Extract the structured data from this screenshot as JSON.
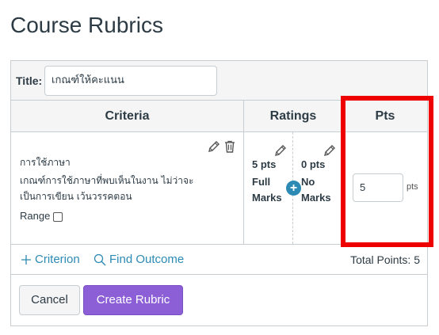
{
  "page": {
    "title": "Course Rubrics"
  },
  "rubric": {
    "title_label": "Title:",
    "title_value": "เกณฑ์ให้คะแนน",
    "headers": {
      "criteria": "Criteria",
      "ratings": "Ratings",
      "pts": "Pts"
    },
    "criterion": {
      "name": "การใช้ภาษา",
      "description": "เกณฑ์การใช้ภาษาที่พบเห็นในงาน ไม่ว่าจะเป็นการเขียน เว้นวรรคตอน",
      "range_label": "Range",
      "range_checked": false,
      "ratings": [
        {
          "points": "5 pts",
          "label": "Full Marks"
        },
        {
          "points": "0 pts",
          "label": "No Marks"
        }
      ],
      "points_value": "5",
      "points_unit": "pts"
    },
    "add_criterion_label": "Criterion",
    "find_outcome_label": "Find Outcome",
    "total_points": "Total Points: 5"
  },
  "actions": {
    "cancel_label": "Cancel",
    "create_label": "Create Rubric"
  },
  "colors": {
    "accent": "#2d8ab5",
    "primary_button": "#8c5fd7",
    "highlight": "#ee0000",
    "text": "#2d3b45",
    "border": "#c7cdd1"
  },
  "icons": [
    "pencil-icon",
    "trash-icon",
    "plus-circle-icon",
    "plus-icon",
    "search-icon"
  ]
}
